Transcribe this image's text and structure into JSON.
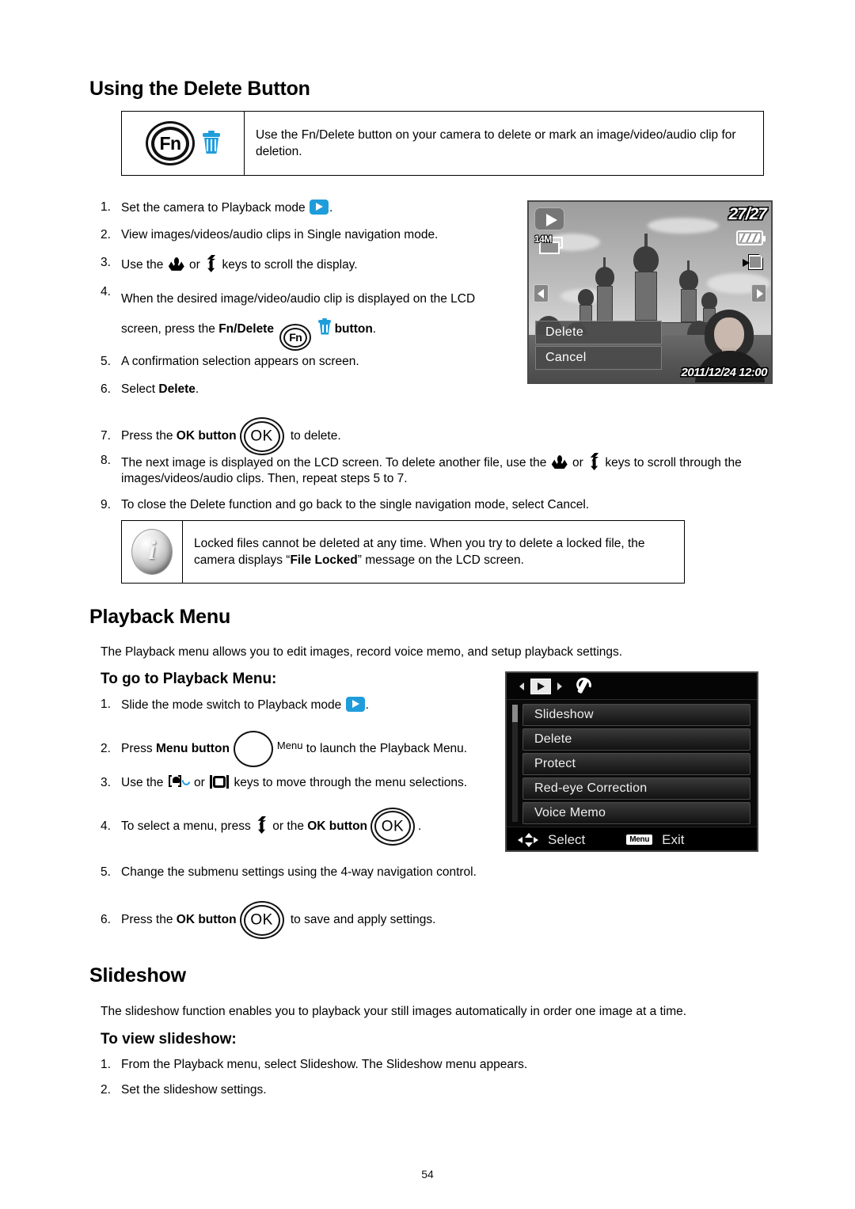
{
  "page": {
    "number": "54"
  },
  "delete_section": {
    "title": "Using the Delete Button",
    "note": {
      "icon_fn_label": "Fn",
      "text": "Use the Fn/Delete button on your camera to delete or mark an image/video/audio clip for deletion."
    },
    "steps": [
      {
        "num": "1.",
        "pre": "Set the camera to Playback mode ",
        "icon": "playback-mode-icon",
        "post": "."
      },
      {
        "num": "2.",
        "pre": "View images/videos/audio clips in Single navigation mode.",
        "post": ""
      },
      {
        "num": "3.",
        "pre": "Use the ",
        "mid": " or ",
        "post": " keys to scroll the display."
      },
      {
        "num": "4.",
        "pre": "When the desired image/video/audio clip is displayed on the LCD screen, press the ",
        "bold1": "Fn/Delete",
        "post": "button",
        "period": "."
      },
      {
        "num": "5.",
        "pre": "A confirmation selection appears on screen.",
        "post": ""
      },
      {
        "num": "6.",
        "pre": "Select ",
        "bold1": "Delete",
        "post": "."
      },
      {
        "num": "7.",
        "pre": "Press the ",
        "bold1": "OK button",
        "post": " to delete."
      },
      {
        "num": "8.",
        "pre": "The next image is displayed on the LCD screen. To delete another file, use the ",
        "mid": " or ",
        "post": " keys to scroll through the images/videos/audio clips. Then, repeat steps 5 to 7."
      },
      {
        "num": "9.",
        "pre": "To close the Delete function and go back to the single navigation mode, select Cancel.",
        "post": ""
      }
    ],
    "info_note": {
      "text_part1": "Locked files cannot be deleted at any time. When you try to delete a locked file, the camera displays “",
      "bold": "File Locked",
      "text_part2": "” message on the LCD screen."
    }
  },
  "photo_lcd": {
    "counter": "27/27",
    "resolution": "14M",
    "datetime": "2011/12/24 12:00",
    "confirm_options": [
      "Delete",
      "Cancel"
    ]
  },
  "playback_menu_section": {
    "title": "Playback Menu",
    "intro": "The Playback menu allows you to edit images, record voice memo, and setup playback settings.",
    "subtitle": "To go to Playback Menu:",
    "steps": [
      {
        "num": "1.",
        "pre": "Slide the mode switch to Playback mode ",
        "post": "."
      },
      {
        "num": "2.",
        "pre": "Press ",
        "bold1": "Menu button",
        "menu_label": "Menu",
        "post": " to launch the Playback Menu."
      },
      {
        "num": "3.",
        "pre": "Use the ",
        "mid": " or ",
        "post": " keys to move through the menu selections."
      },
      {
        "num": "4.",
        "pre": "To select a menu, press ",
        "mid": " or the ",
        "bold1": "OK button",
        "post": "."
      },
      {
        "num": "5.",
        "pre": "Change the submenu settings using the 4-way navigation control.",
        "post": ""
      },
      {
        "num": "6.",
        "pre": "Press the ",
        "bold1": "OK button",
        "post": " to save and apply settings."
      }
    ]
  },
  "menu_lcd": {
    "items": [
      "Slideshow",
      "Delete",
      "Protect",
      "Red-eye Correction",
      "Voice Memo"
    ],
    "select_label": "Select",
    "exit_badge": "Menu",
    "exit_label": "Exit"
  },
  "slideshow_section": {
    "title": "Slideshow",
    "intro": "The slideshow function enables you to playback your still images automatically in order one image at a time.",
    "subtitle": "To view slideshow:",
    "steps": [
      {
        "num": "1.",
        "pre": "From the Playback menu, select Slideshow. The Slideshow menu appears."
      },
      {
        "num": "2.",
        "pre": "Set the slideshow settings."
      }
    ]
  }
}
